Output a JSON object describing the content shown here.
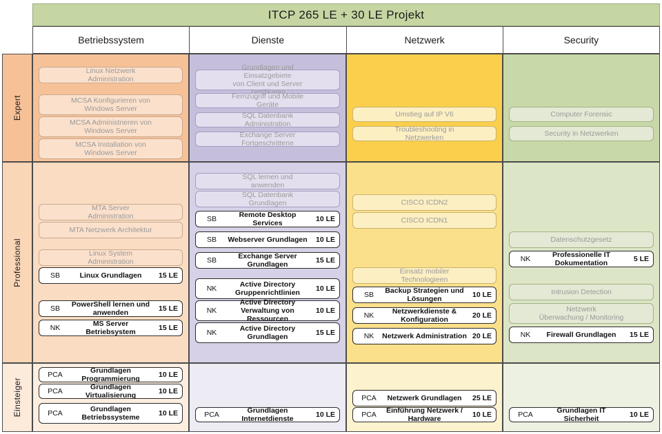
{
  "header": {
    "title": "ITCP  265 LE + 30 LE Projekt",
    "columns": [
      "Betriebssystem",
      "Dienste",
      "Netzwerk",
      "Security"
    ]
  },
  "levels": [
    "Expert",
    "Professional",
    "Einsteiger"
  ],
  "cards": {
    "expert_os": [
      {
        "code": "",
        "title": "Linux Netzwerk Administration",
        "le": "",
        "state": "ghost"
      },
      {
        "code": "",
        "title": "MCSA Konfigurieren von\nWindows Server",
        "le": "",
        "state": "ghost"
      },
      {
        "code": "",
        "title": "MCSA Administrieren von\nWindows Server",
        "le": "",
        "state": "ghost"
      },
      {
        "code": "",
        "title": "MCSA Installation von\nWindows Server",
        "le": "",
        "state": "ghost"
      }
    ],
    "expert_dienste": [
      {
        "code": "",
        "title": "Grundlagen und Einsatzgebiete\nvon Client und Server Zertifikaten",
        "le": "",
        "state": "ghost"
      },
      {
        "code": "",
        "title": "Fernzugriff und Mobile Geräte",
        "le": "",
        "state": "ghost"
      },
      {
        "code": "",
        "title": "SQL Datenbank Administration",
        "le": "",
        "state": "ghost"
      },
      {
        "code": "",
        "title": "Exchange Server Fortgeschrittene",
        "le": "",
        "state": "ghost"
      }
    ],
    "expert_netzwerk": [
      {
        "code": "",
        "title": "Umstieg auf IP V6",
        "le": "",
        "state": "ghost"
      },
      {
        "code": "",
        "title": "Troubleshooting in Netzwerken",
        "le": "",
        "state": "ghost"
      }
    ],
    "expert_security": [
      {
        "code": "",
        "title": "Computer Forensic",
        "le": "",
        "state": "ghost"
      },
      {
        "code": "",
        "title": "Security in Netzwerken",
        "le": "",
        "state": "ghost"
      }
    ],
    "prof_os": [
      {
        "code": "",
        "title": "MTA Server Administration",
        "le": "",
        "state": "ghost"
      },
      {
        "code": "",
        "title": "MTA Netzwerk Architektur",
        "le": "",
        "state": "ghost"
      },
      {
        "code": "",
        "title": "Linux System Administration",
        "le": "",
        "state": "ghost"
      },
      {
        "code": "SB",
        "title": "Linux Grundlagen",
        "le": "15 LE",
        "state": "active"
      },
      {
        "code": "SB",
        "title": "PowerShell lernen und anwenden",
        "le": "15 LE",
        "state": "active"
      },
      {
        "code": "NK",
        "title": "MS Server Betriebsystem",
        "le": "15 LE",
        "state": "active"
      }
    ],
    "prof_dienste": [
      {
        "code": "",
        "title": "SQL lernen und anwenden",
        "le": "",
        "state": "ghost"
      },
      {
        "code": "",
        "title": "SQL Datenbank Grundlagen",
        "le": "",
        "state": "ghost"
      },
      {
        "code": "SB",
        "title": "Remote Desktop Services",
        "le": "10 LE",
        "state": "active"
      },
      {
        "code": "SB",
        "title": "Webserver Grundlagen",
        "le": "10 LE",
        "state": "active"
      },
      {
        "code": "SB",
        "title": "Exchange Server Grundlagen",
        "le": "15 LE",
        "state": "active"
      },
      {
        "code": "NK",
        "title": "Active Directory\nGruppenrichtlinien",
        "le": "10 LE",
        "state": "active"
      },
      {
        "code": "NK",
        "title": "Active Directory\nVerwaltung von Ressourcen",
        "le": "10 LE",
        "state": "active"
      },
      {
        "code": "NK",
        "title": "Active Directory\nGrundlagen",
        "le": "15 LE",
        "state": "active"
      }
    ],
    "prof_netzwerk": [
      {
        "code": "",
        "title": "CISCO ICDN2",
        "le": "",
        "state": "ghost"
      },
      {
        "code": "",
        "title": "CISCO ICDN1",
        "le": "",
        "state": "ghost"
      },
      {
        "code": "",
        "title": "Einsatz mobiler Technologieen",
        "le": "",
        "state": "ghost"
      },
      {
        "code": "SB",
        "title": "Backup Strategien und Lösungen",
        "le": "10 LE",
        "state": "active"
      },
      {
        "code": "NK",
        "title": "Netzwerkdienste & Konfiguration",
        "le": "20 LE",
        "state": "active"
      },
      {
        "code": "NK",
        "title": "Netzwerk Administration",
        "le": "20 LE",
        "state": "active"
      }
    ],
    "prof_security": [
      {
        "code": "",
        "title": "Datenschutzgesetz",
        "le": "",
        "state": "ghost"
      },
      {
        "code": "NK",
        "title": "Professionelle IT Dokumentation",
        "le": "5 LE",
        "state": "active"
      },
      {
        "code": "",
        "title": "Intrusion Detection",
        "le": "",
        "state": "ghost"
      },
      {
        "code": "",
        "title": "Netzwerk\nÜberwachung / Monitoring",
        "le": "",
        "state": "ghost"
      },
      {
        "code": "NK",
        "title": "Firewall Grundlagen",
        "le": "15 LE",
        "state": "active"
      }
    ],
    "einst_os": [
      {
        "code": "PCA",
        "title": "Grundlagen Programmierung",
        "le": "10 LE",
        "state": "active"
      },
      {
        "code": "PCA",
        "title": "Grundlagen Virtualisierung",
        "le": "10 LE",
        "state": "active"
      },
      {
        "code": "PCA",
        "title": "Grundlagen\nBetriebssysteme",
        "le": "10 LE",
        "state": "active"
      }
    ],
    "einst_dienste": [
      {
        "code": "PCA",
        "title": "Grundlagen Internetdienste",
        "le": "10 LE",
        "state": "active"
      }
    ],
    "einst_netzwerk": [
      {
        "code": "PCA",
        "title": "Netzwerk Grundlagen",
        "le": "25 LE",
        "state": "active"
      },
      {
        "code": "PCA",
        "title": "Einführung  Netzwerk / Hardware",
        "le": "10 LE",
        "state": "active"
      }
    ],
    "einst_security": [
      {
        "code": "PCA",
        "title": "Grundlagen IT Sicherheit",
        "le": "10 LE",
        "state": "active"
      }
    ]
  },
  "colors": {
    "title_bar": "#C5D6A2",
    "betriebssystem": "#F7C197",
    "dienste": "#C6BFDC",
    "netzwerk": "#FBCF4C",
    "security": "#C9D8A8"
  }
}
